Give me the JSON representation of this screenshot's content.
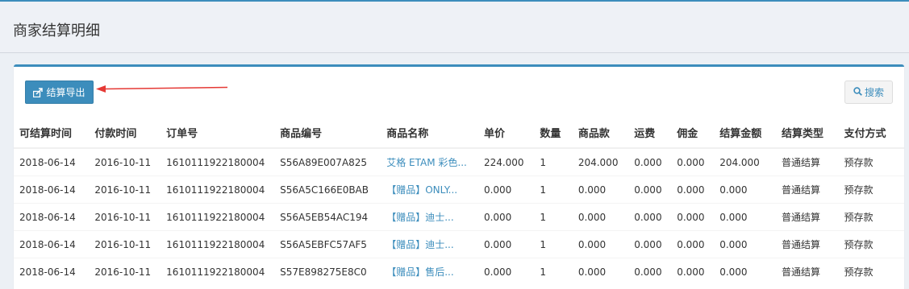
{
  "page": {
    "title": "商家结算明细"
  },
  "toolbar": {
    "export_label": "结算导出",
    "search_label": "搜索"
  },
  "colors": {
    "primary": "#3c8dbc",
    "arrow": "#e53935"
  },
  "icons": {
    "export": "export-icon",
    "search": "search-icon"
  },
  "table": {
    "columns": [
      "可结算时间",
      "付款时间",
      "订单号",
      "商品编号",
      "商品名称",
      "单价",
      "数量",
      "商品款",
      "运费",
      "佣金",
      "结算金额",
      "结算类型",
      "支付方式"
    ],
    "rows": [
      [
        "2018-06-14",
        "2016-10-11",
        "1610111922180004",
        "S56A89E007A825",
        "艾格 ETAM 彩色...",
        "224.000",
        "1",
        "204.000",
        "0.000",
        "0.000",
        "204.000",
        "普通结算",
        "预存款"
      ],
      [
        "2018-06-14",
        "2016-10-11",
        "1610111922180004",
        "S56A5C166E0BAB",
        "【赠品】ONLY...",
        "0.000",
        "1",
        "0.000",
        "0.000",
        "0.000",
        "0.000",
        "普通结算",
        "预存款"
      ],
      [
        "2018-06-14",
        "2016-10-11",
        "1610111922180004",
        "S56A5EB54AC194",
        "【赠品】迪士...",
        "0.000",
        "1",
        "0.000",
        "0.000",
        "0.000",
        "0.000",
        "普通结算",
        "预存款"
      ],
      [
        "2018-06-14",
        "2016-10-11",
        "1610111922180004",
        "S56A5EBFC57AF5",
        "【赠品】迪士...",
        "0.000",
        "1",
        "0.000",
        "0.000",
        "0.000",
        "0.000",
        "普通结算",
        "预存款"
      ],
      [
        "2018-06-14",
        "2016-10-11",
        "1610111922180004",
        "S57E898275E8C0",
        "【赠品】售后...",
        "0.000",
        "1",
        "0.000",
        "0.000",
        "0.000",
        "0.000",
        "普通结算",
        "预存款"
      ]
    ]
  }
}
